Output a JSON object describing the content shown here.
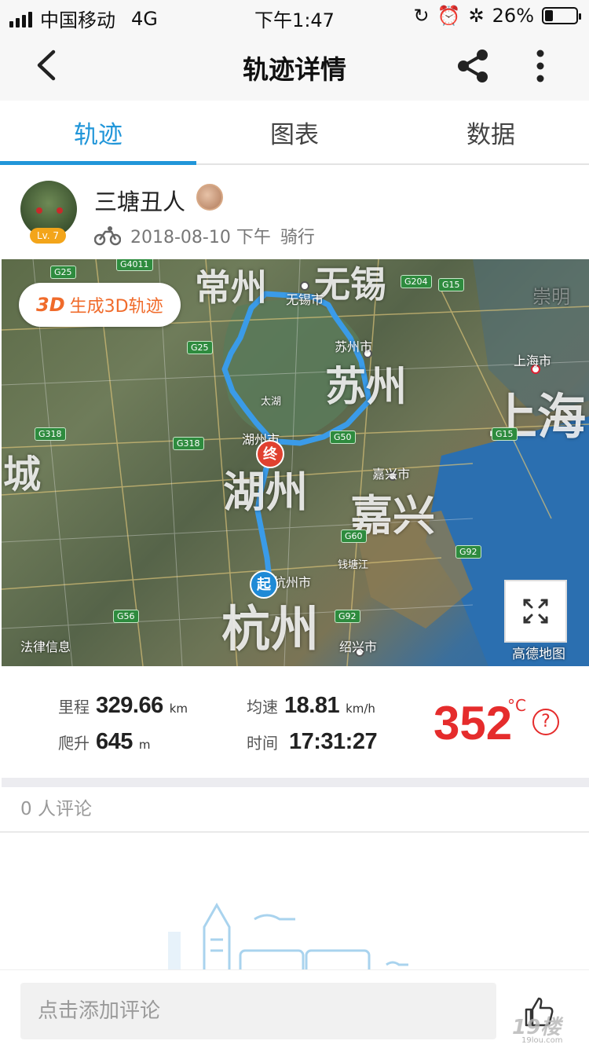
{
  "status_bar": {
    "carrier": "中国移动",
    "network": "4G",
    "time": "下午1:47",
    "battery_percent": "26%",
    "battery_level": 0.26
  },
  "nav": {
    "title": "轨迹详情",
    "icons": [
      "back-icon",
      "share-icon",
      "more-icon"
    ]
  },
  "tabs": [
    {
      "label": "轨迹",
      "active": true
    },
    {
      "label": "图表",
      "active": false
    },
    {
      "label": "数据",
      "active": false
    }
  ],
  "user": {
    "name": "三塘丑人",
    "level": "Lv. 7",
    "date": "2018-08-10 下午",
    "activity": "骑行"
  },
  "map": {
    "btn_3d_logo": "3D",
    "btn_3d_label": "生成3D轨迹",
    "cities": {
      "changzhou": "常州",
      "wuxi": "无锡",
      "suzhou": "苏州",
      "shanghai": "上海",
      "huzhou": "湖州",
      "jiaxing": "嘉兴",
      "hangzhou": "杭州",
      "cheng": "城"
    },
    "small_labels": {
      "wuxi_shi": "无锡市",
      "suzhou_shi": "苏州市",
      "shanghai_shi": "上海市",
      "huzhou_shi": "湖州市",
      "jiaxing_shi": "嘉兴市",
      "hangzhou_shi": "杭州市",
      "shaoxing_shi": "绍兴市",
      "taihu": "太湖",
      "qiantang": "钱塘江",
      "chongming": "崇明"
    },
    "roads": [
      "G25",
      "G4011",
      "G204",
      "G15",
      "G25",
      "G318",
      "G318",
      "G50",
      "G15",
      "G60",
      "G92",
      "G56",
      "G92"
    ],
    "pin_end": "终",
    "pin_start": "起",
    "legal": "法律信息",
    "brand": "高德地图"
  },
  "stats": {
    "distance": {
      "label": "里程",
      "value": "329.66",
      "unit": "km"
    },
    "climb": {
      "label": "爬升",
      "value": "645",
      "unit": "m"
    },
    "avg_speed": {
      "label": "均速",
      "value": "18.81",
      "unit": "km/h"
    },
    "duration": {
      "label": "时间",
      "value": "17:31:27"
    },
    "temperature": {
      "value": "352",
      "unit": "°C"
    }
  },
  "comments": {
    "count_text": "0 人评论",
    "input_placeholder": "点击添加评论"
  },
  "watermark": {
    "logo": "19楼",
    "domain": "19lou.com"
  },
  "colors": {
    "accent": "#2196d9",
    "temperature": "#e52c2c",
    "brand_3d": "#f06b2b",
    "route": "#3a9be8"
  }
}
